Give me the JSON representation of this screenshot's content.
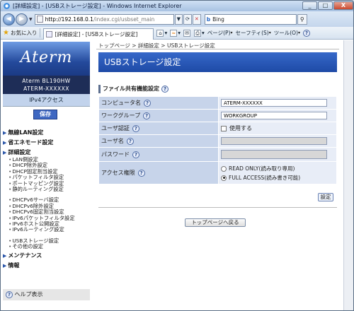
{
  "window": {
    "title": "[詳細設定] - [USBストレージ設定] - Windows Internet Explorer",
    "minimize": "_",
    "maximize": "□",
    "close": "X"
  },
  "address": {
    "host": "http://192.168.0.1",
    "path": "/index.cgi/usbset_main",
    "search_engine": "Bing"
  },
  "favorites": {
    "label": "お気に入り",
    "tab_title": "[詳細設定] - [USBストレージ設定]",
    "page_menu": "ページ(P)",
    "safety_menu": "セーフティ(S)",
    "tools_menu": "ツール(O)"
  },
  "brand": {
    "logo": "Aterm",
    "model_line1": "Aterm BL190HW",
    "model_line2": "ATERM-XXXXXX",
    "mode": "IPv4アクセス",
    "save": "保存"
  },
  "menu": {
    "wireless_lan": "無線LAN設定",
    "eco": "省エネモード設定",
    "advanced": "詳細設定",
    "advanced_items_a": [
      "LAN側設定",
      "DHCP除外設定",
      "DHCP固定割当設定",
      "パケットフィルタ設定",
      "ポートマッピング設定",
      "静的ルーティング設定"
    ],
    "advanced_items_b": [
      "DHCPv6サーバ設定",
      "DHCPv6除外設定",
      "DHCPv6固定割当設定",
      "IPv6パケットフィルタ設定",
      "IPv6ホスト公開設定",
      "IPv6ルーティング設定"
    ],
    "advanced_items_c": [
      "USBストレージ設定",
      "その他の設定"
    ],
    "maintenance": "メンテナンス",
    "info": "情報",
    "help": "ヘルプ表示"
  },
  "main": {
    "breadcrumb": "トップページ > 詳細設定 > USBストレージ設定",
    "title": "USBストレージ設定",
    "section": "ファイル共有機能設定",
    "rows": {
      "computer_name": {
        "label": "コンピュータ名",
        "value": "ATERM-XXXXXX"
      },
      "workgroup": {
        "label": "ワークグループ",
        "value": "WORKGROUP"
      },
      "user_auth": {
        "label": "ユーザ認証",
        "option": "使用する",
        "checked": false
      },
      "user_name": {
        "label": "ユーザ名",
        "value": ""
      },
      "password": {
        "label": "パスワード",
        "value": ""
      },
      "access": {
        "label": "アクセス権限",
        "option_ro": "READ ONLY(読み取り専用)",
        "option_fa": "FULL ACCESS(読み書き可能)",
        "selected": "FULL ACCESS(読み書き可能)"
      }
    },
    "set_button": "設定",
    "top_button": "トップページへ戻る"
  },
  "help_glyph": "?",
  "colors": {
    "title_bar": "#2a58b5",
    "label_cell": "#c7d4ea",
    "value_cell": "#e8edf7",
    "logo_bg": "#3a64b8",
    "model_bg": "#1e2d57"
  }
}
